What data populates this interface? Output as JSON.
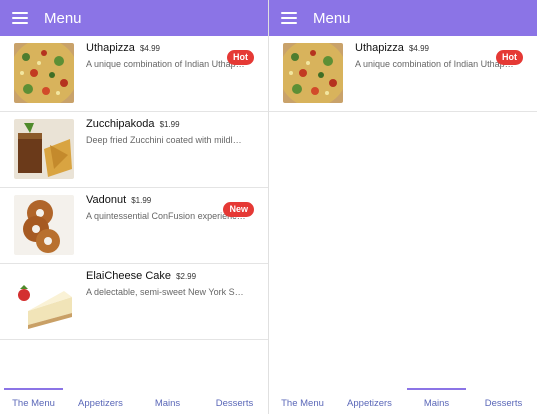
{
  "left_screen": {
    "header": {
      "title": "Menu",
      "menu_icon": "hamburger-menu-icon"
    },
    "dishes": [
      {
        "name": "Uthapizza",
        "price": "$4.99",
        "description": "A unique combination of Indian Uthappam (pancake) and Italian pizza",
        "badge": "Hot"
      },
      {
        "name": "Zucchipakoda",
        "price": "$1.99",
        "description": "Deep fried Zucchini coated with mildly spiced Chickpea flour batter",
        "badge": ""
      },
      {
        "name": "Vadonut",
        "price": "$1.99",
        "description": "A quintessential ConFusion experience, is it a vada or is it a donut?",
        "badge": "New"
      },
      {
        "name": "ElaiCheese Cake",
        "price": "$2.99",
        "description": "A delectable, semi-sweet New York Style Cheese Cake",
        "badge": ""
      }
    ],
    "tabs": [
      {
        "label": "The Menu",
        "active": true
      },
      {
        "label": "Appetizers",
        "active": false
      },
      {
        "label": "Mains",
        "active": false
      },
      {
        "label": "Desserts",
        "active": false
      }
    ]
  },
  "right_screen": {
    "header": {
      "title": "Menu",
      "menu_icon": "hamburger-menu-icon"
    },
    "dishes": [
      {
        "name": "Uthapizza",
        "price": "$4.99",
        "description": "A unique combination of Indian Uthappam (pancake) and Italian pizza",
        "badge": "Hot"
      }
    ],
    "tabs": [
      {
        "label": "The Menu",
        "active": false
      },
      {
        "label": "Appetizers",
        "active": false
      },
      {
        "label": "Mains",
        "active": true
      },
      {
        "label": "Desserts",
        "active": false
      }
    ]
  },
  "colors": {
    "app_bar": "#8b74e6",
    "badge": "#e53935",
    "tab_text": "#5a67b8",
    "tab_indicator": "#8b74e6"
  }
}
